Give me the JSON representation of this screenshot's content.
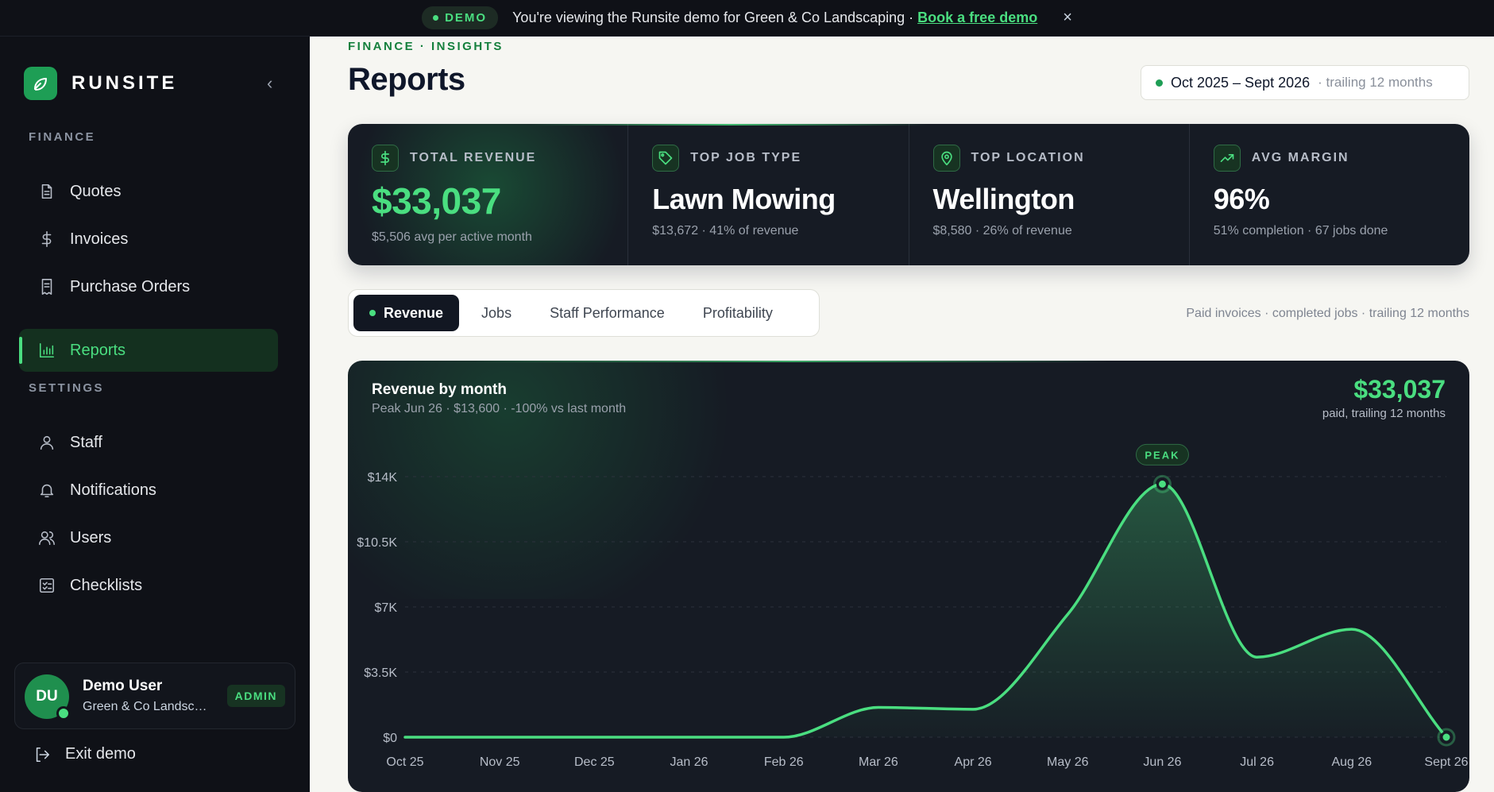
{
  "banner": {
    "badge": "DEMO",
    "message": "You're viewing the Runsite demo for Green & Co Landscaping ·",
    "link": "Book a free demo",
    "close": "×"
  },
  "sidebar": {
    "brand": "RUNSITE",
    "collapse": "‹",
    "finance_label": "FINANCE",
    "settings_label": "SETTINGS",
    "finance_items": [
      {
        "label": "Quotes",
        "icon": "document-icon"
      },
      {
        "label": "Invoices",
        "icon": "dollar-icon"
      },
      {
        "label": "Purchase Orders",
        "icon": "receipt-icon"
      },
      {
        "label": "Reports",
        "icon": "bar-chart-icon",
        "active": true
      }
    ],
    "settings_items": [
      {
        "label": "Staff",
        "icon": "user-icon"
      },
      {
        "label": "Notifications",
        "icon": "bell-icon"
      },
      {
        "label": "Users",
        "icon": "users-icon"
      },
      {
        "label": "Checklists",
        "icon": "checklist-icon"
      }
    ],
    "user": {
      "initials": "DU",
      "name": "Demo User",
      "org": "Green & Co Landscaping",
      "role": "ADMIN"
    },
    "exit": "Exit demo"
  },
  "main": {
    "breadcrumb": "FINANCE · INSIGHTS",
    "title": "Reports",
    "range": {
      "dates": "Oct 2025 – Sept 2026",
      "note": "· trailing 12 months"
    },
    "kpis": [
      {
        "label": "TOTAL REVENUE",
        "value": "$33,037",
        "sub": "$5,506 avg per active month",
        "icon": "dollar-icon"
      },
      {
        "label": "TOP JOB TYPE",
        "value": "Lawn Mowing",
        "sub": "$13,672 · 41% of revenue",
        "icon": "tag-icon"
      },
      {
        "label": "TOP LOCATION",
        "value": "Wellington",
        "sub": "$8,580 · 26% of revenue",
        "icon": "location-pin-icon"
      },
      {
        "label": "AVG MARGIN",
        "value": "96%",
        "sub": "51% completion · 67 jobs done",
        "icon": "trending-up-icon"
      }
    ],
    "tabs": [
      "Revenue",
      "Jobs",
      "Staff Performance",
      "Profitability"
    ],
    "active_tab": "Revenue",
    "tabs_meta": "Paid invoices · completed jobs · trailing 12 months",
    "chart_card": {
      "title": "Revenue by month",
      "subtitle": "Peak Jun 26 · $13,600 · -100% vs last month",
      "total": "$33,037",
      "total_sub": "paid, trailing 12 months"
    }
  },
  "colors": {
    "accent": "#4ade80",
    "brand": "#1e9e55",
    "dark": "#161b24"
  },
  "chart_data": {
    "type": "area",
    "title": "Revenue by month",
    "categories": [
      "Oct 25",
      "Nov 25",
      "Dec 25",
      "Jan 26",
      "Feb 26",
      "Mar 26",
      "Apr 26",
      "May 26",
      "Jun 26",
      "Jul 26",
      "Aug 26",
      "Sept 26"
    ],
    "series": [
      {
        "values": [
          0,
          0,
          0,
          0,
          0,
          1600,
          1500,
          6600,
          13600,
          4300,
          5800,
          0
        ]
      }
    ],
    "y_ticks": [
      "$0",
      "$3.5K",
      "$7K",
      "$10.5K",
      "$14K"
    ],
    "ylim": [
      0,
      14000
    ],
    "peak_label": "PEAK",
    "peak_index": 8,
    "grid": true
  }
}
